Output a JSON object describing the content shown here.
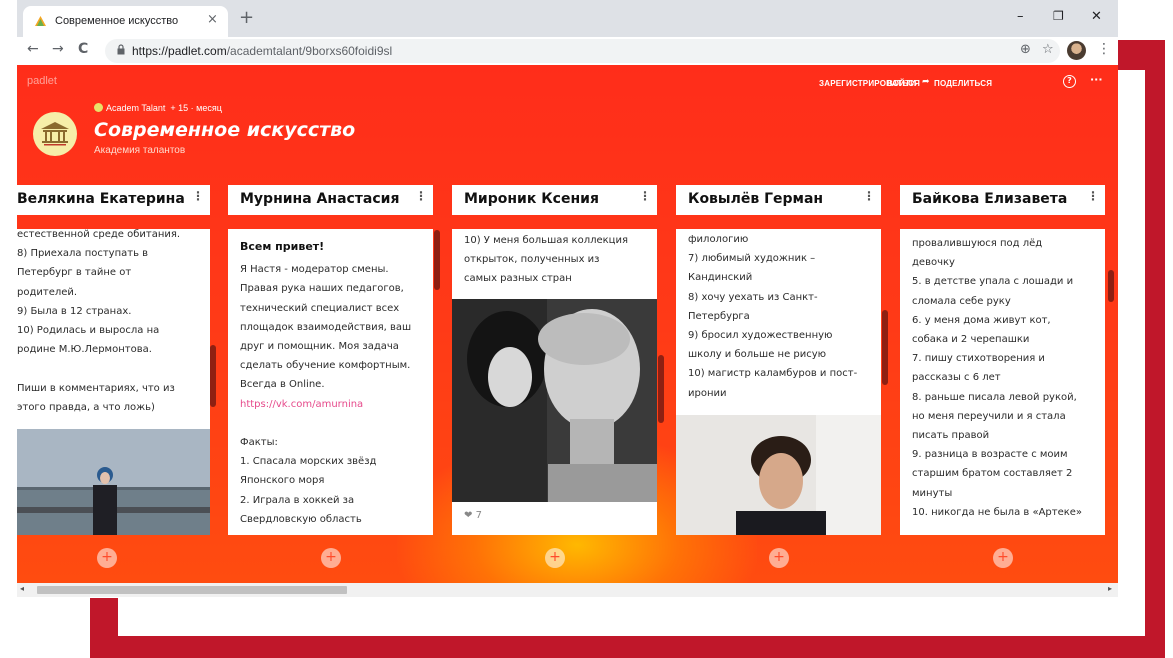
{
  "browser": {
    "tab_title": "Современное искусство",
    "tab_close": "×",
    "new_tab": "+",
    "back": "←",
    "forward": "→",
    "reload": "C",
    "url_main": "https://padlet.com",
    "url_path": "/academtalant/9borxs60foidi9sl",
    "window_min": "–",
    "window_max": "❐",
    "window_close": "✕",
    "zoom_icon": "⊕",
    "bookmark_icon": "☆",
    "menu_icon": "⋮"
  },
  "padlet": {
    "brand": "padlet",
    "nav": {
      "register": "ЗАРЕГИСТРИРОВАТЬСЯ",
      "login": "ВОЙТИ",
      "share": "ПОДЕЛИТЬСЯ"
    },
    "help": "?",
    "more": "···",
    "author": "Academ Talant",
    "meta": "+ 15  ·  месяц",
    "title": "Современное искусство",
    "subtitle": "Академия талантов",
    "add": "+",
    "colors": {
      "accent": "#ff2d1a",
      "glow": "#ffb000",
      "link": "#e64a8b"
    }
  },
  "columns": [
    {
      "title": "Велякина Екатерина",
      "lines": [
        "естественной среде обитания.",
        "8) Приехала поступать в",
        "Петербург в тайне от",
        "родителей.",
        "9) Была в 12 странах.",
        "10) Родилась и выросла на",
        "родине М.Ю.Лермонтова.",
        "",
        "Пиши в комментариях, что из",
        "этого правда, а что ложь)"
      ]
    },
    {
      "title": "Мурнина Анастасия",
      "greeting": "Всем привет!",
      "lines": [
        "Я Настя - модератор смены.",
        "Правая рука наших педагогов,",
        "технический специалист всех",
        "площадок взаимодействия, ваш",
        "друг и помощник. Моя задача",
        "сделать обучение комфортным.",
        "Всегда в Online."
      ],
      "link": "https://vk.com/amurnina",
      "facts_label": "Факты:",
      "facts": [
        "1. Спасала морских звёзд",
        "Японского моря",
        "2. Играла в хоккей за",
        "Свердловскую область"
      ]
    },
    {
      "title": "Мироник Ксения",
      "lines": [
        "10) У меня большая коллекция",
        "открыток, полученных из",
        "самых разных стран"
      ],
      "likes": "7"
    },
    {
      "title": "Ковылёв Герман",
      "lines": [
        "филологию",
        "7) любимый художник –",
        "Кандинский",
        "8) хочу уехать из Санкт-",
        "Петербурга",
        "9) бросил художественную",
        "школу и больше не рисую",
        "10) магистр каламбуров и пост-",
        "иронии"
      ]
    },
    {
      "title": "Байкова Елизавета",
      "lines": [
        "провалившуюся под лёд",
        "девочку",
        "5. в детстве упала с лошади и",
        "сломала себе руку",
        "6. у меня дома живут кот,",
        "собака и 2 черепашки",
        "7. пишу стихотворения и",
        "рассказы с 6 лет",
        "8. раньше писала левой рукой,",
        "но меня переучили и я стала",
        "писать правой",
        "9. разница в возрасте с моим",
        "старшим братом составляет 2",
        "минуты",
        "10. никогда не была в «Артеке»"
      ]
    }
  ],
  "scrollbar": {
    "left_arrow": "◂",
    "right_arrow": "▸"
  }
}
